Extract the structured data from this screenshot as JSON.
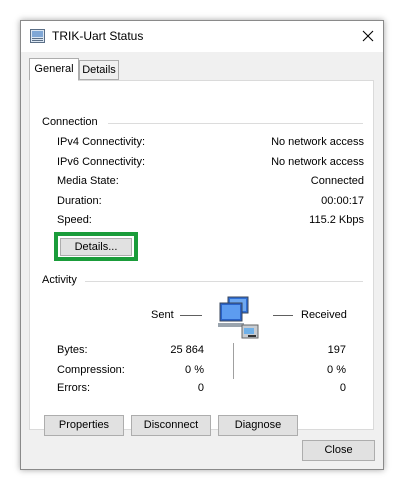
{
  "window": {
    "title": "TRIK-Uart Status"
  },
  "tabs": [
    "General",
    "Details"
  ],
  "connection": {
    "heading": "Connection",
    "rows": [
      {
        "label": "IPv4 Connectivity:",
        "value": "No network access"
      },
      {
        "label": "IPv6 Connectivity:",
        "value": "No network access"
      },
      {
        "label": "Media State:",
        "value": "Connected"
      },
      {
        "label": "Duration:",
        "value": "00:00:17"
      },
      {
        "label": "Speed:",
        "value": "115.2 Kbps"
      }
    ],
    "details_button": "Details..."
  },
  "activity": {
    "heading": "Activity",
    "sent_label": "Sent",
    "received_label": "Received",
    "rows": [
      {
        "label": "Bytes:",
        "sent": "25 864",
        "received": "197"
      },
      {
        "label": "Compression:",
        "sent": "0 %",
        "received": "0 %"
      },
      {
        "label": "Errors:",
        "sent": "0",
        "received": "0"
      }
    ]
  },
  "buttons": {
    "properties": "Properties",
    "disconnect": "Disconnect",
    "diagnose": "Diagnose",
    "close": "Close"
  },
  "colors": {
    "highlight": "#1a9c3a"
  },
  "icons": {
    "title": "network-connection-icon",
    "activity": "network-computers-icon"
  }
}
